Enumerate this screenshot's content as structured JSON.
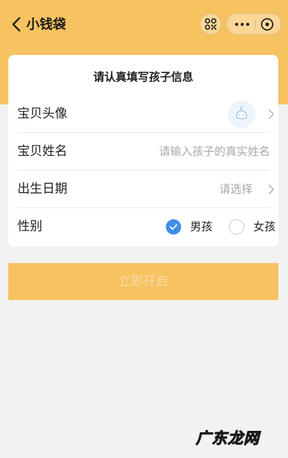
{
  "nav": {
    "title": "小钱袋"
  },
  "form": {
    "title": "请认真填写孩子信息",
    "avatar": {
      "label": "宝贝头像"
    },
    "name": {
      "label": "宝贝姓名",
      "placeholder": "请输入孩子的真实姓名"
    },
    "birthday": {
      "label": "出生日期",
      "placeholder": "请选择"
    },
    "gender": {
      "label": "性别",
      "options": [
        {
          "label": "男孩",
          "selected": true
        },
        {
          "label": "女孩",
          "selected": false
        }
      ]
    }
  },
  "submit_label": "立即开启",
  "watermark": "广东龙网",
  "colors": {
    "accent": "#f7c260",
    "radio_selected": "#3f8fe8",
    "background": "#f2f2f2"
  },
  "icons": {
    "back": "chevron-left-icon",
    "scan": "scan-icon",
    "more": "more-dots-icon",
    "close": "close-circle-icon",
    "avatar": "baby-avatar-icon",
    "chevron": "chevron-right-icon",
    "check": "check-icon"
  }
}
